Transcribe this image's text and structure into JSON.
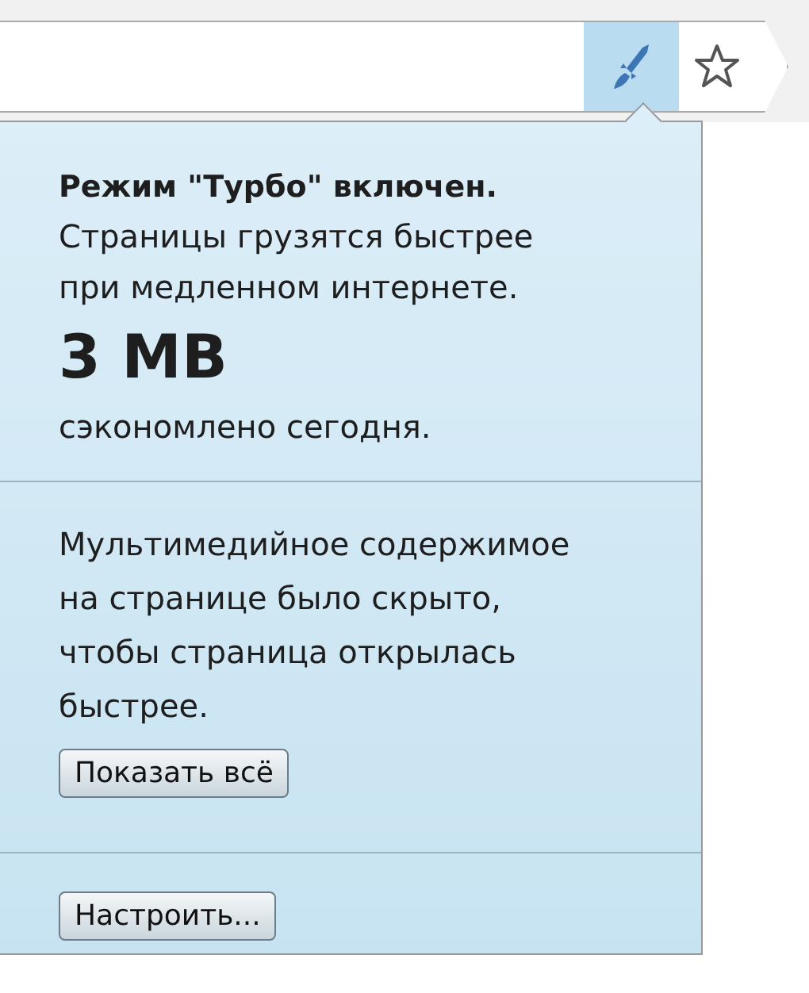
{
  "toolbar": {
    "turbo_button": {
      "active": true
    }
  },
  "popup": {
    "title": "Режим \"Турбо\" включен.",
    "description": "Страницы грузятся быстрее при медленном интернете.",
    "saved_amount": "3 MB",
    "saved_caption": "сэкономлено сегодня.",
    "media_notice": "Мультимедийное содержимое на странице было скрыто, чтобы страница открылась быстрее.",
    "show_all_button": "Показать всё",
    "settings_button": "Настроить..."
  }
}
